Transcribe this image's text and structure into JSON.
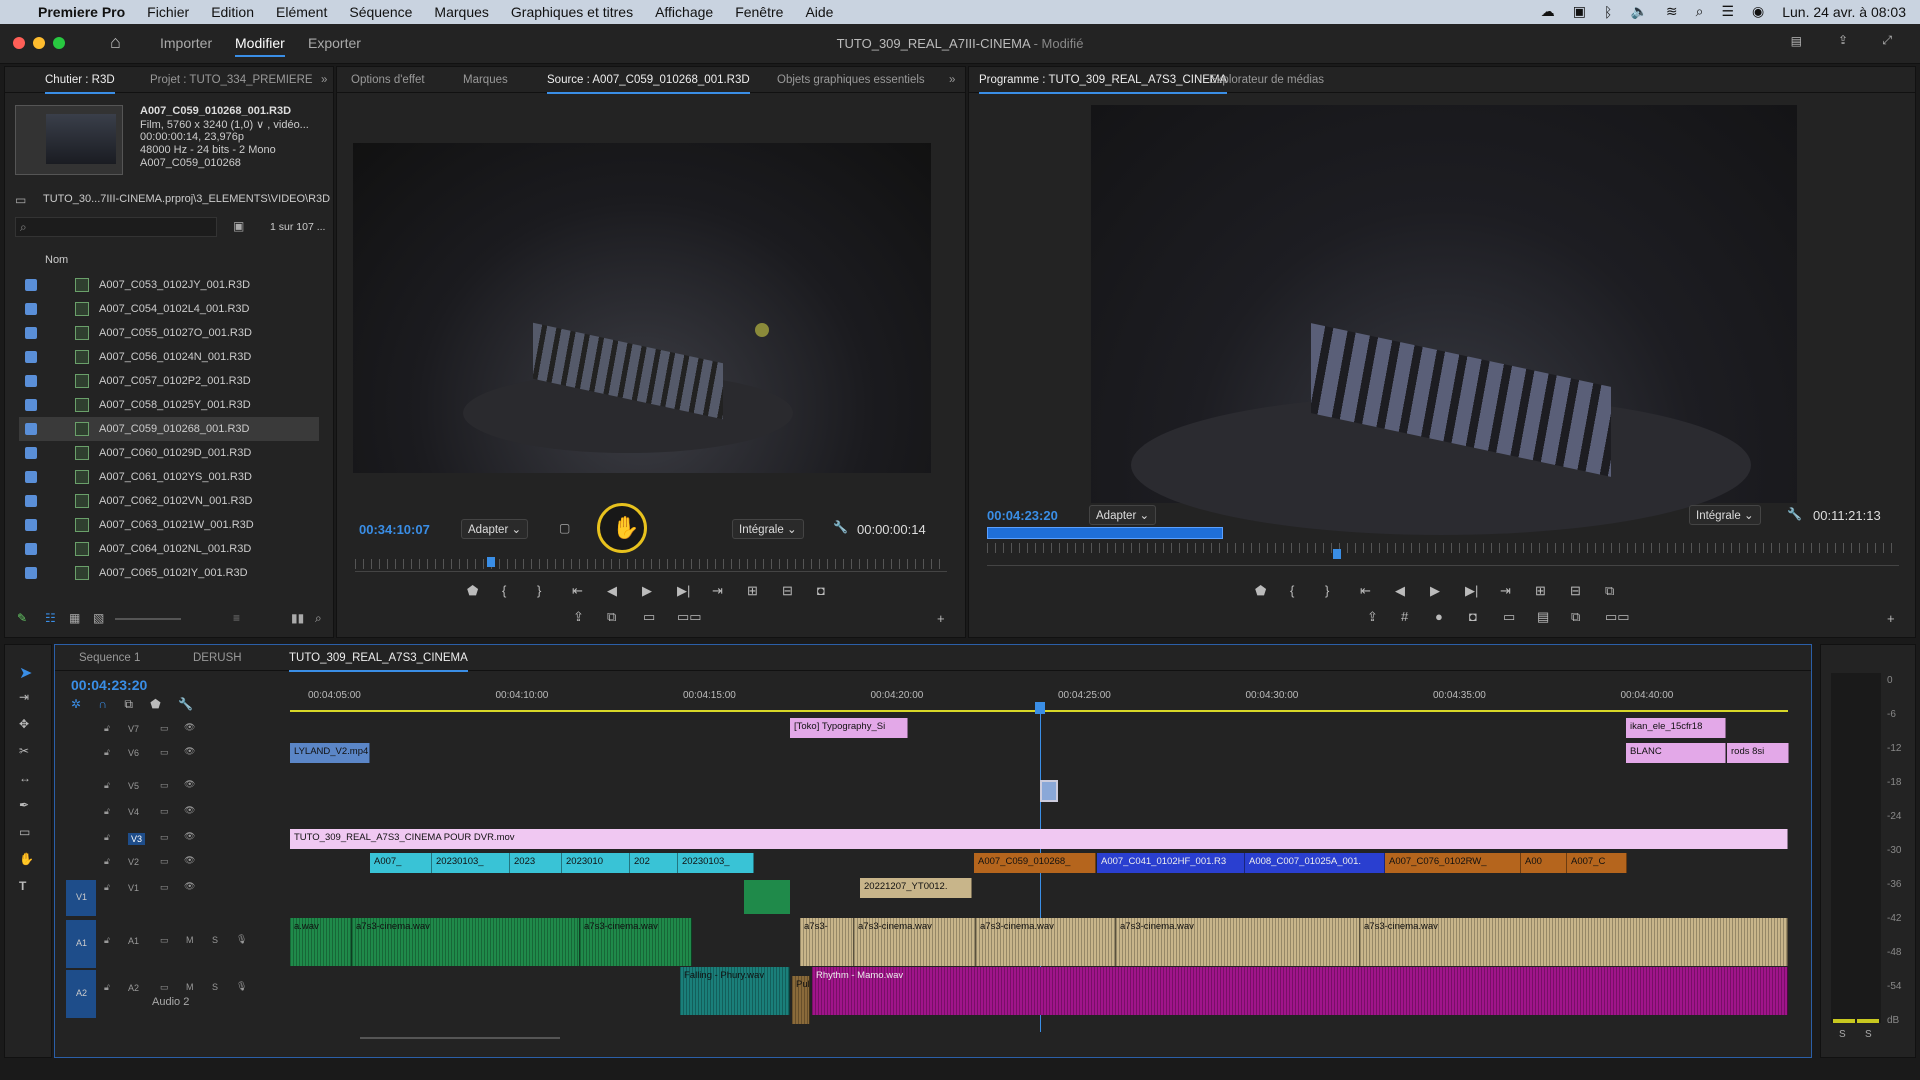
{
  "menubar": {
    "app": "Premiere Pro",
    "items": [
      "Fichier",
      "Edition",
      "Elément",
      "Séquence",
      "Marques",
      "Graphiques et titres",
      "Affichage",
      "Fenêtre",
      "Aide"
    ],
    "datetime": "Lun. 24 avr. à 08:03"
  },
  "titlebar": {
    "tabs": [
      "Importer",
      "Modifier",
      "Exporter"
    ],
    "active_tab": "Modifier",
    "title": "TUTO_309_REAL_A7III-CINEMA",
    "modified": " - Modifié"
  },
  "project": {
    "tabs": [
      "Chutier : R3D",
      "Projet : TUTO_334_PREMIERE"
    ],
    "clip_name": "A007_C059_010268_001.R3D",
    "info": [
      "Film, 5760 x 3240 (1,0) ∨ , vidéo...",
      "00:00:00:14, 23,976p",
      "48000 Hz - 24 bits - 2 Mono",
      "A007_C059_010268"
    ],
    "path": "TUTO_30...7III-CINEMA.prproj\\3_ELEMENTS\\VIDEO\\R3D",
    "count": "1 sur 107 ...",
    "column": "Nom",
    "files": [
      "A007_C053_0102JY_001.R3D",
      "A007_C054_0102L4_001.R3D",
      "A007_C055_01027O_001.R3D",
      "A007_C056_01024N_001.R3D",
      "A007_C057_0102P2_001.R3D",
      "A007_C058_01025Y_001.R3D",
      "A007_C059_010268_001.R3D",
      "A007_C060_01029D_001.R3D",
      "A007_C061_0102YS_001.R3D",
      "A007_C062_0102VN_001.R3D",
      "A007_C063_01021W_001.R3D",
      "A007_C064_0102NL_001.R3D",
      "A007_C065_0102IY_001.R3D"
    ],
    "selected_index": 6
  },
  "source": {
    "tabs": [
      "Options d'effet",
      "Marques",
      "Source : A007_C059_010268_001.R3D",
      "Objets graphiques essentiels"
    ],
    "timecode": "00:34:10:07",
    "fit": "Adapter",
    "quality": "Intégrale",
    "duration": "00:00:00:14"
  },
  "program": {
    "tabs": [
      "Programme : TUTO_309_REAL_A7S3_CINEMA",
      "Explorateur de médias"
    ],
    "timecode": "00:04:23:20",
    "fit": "Adapter",
    "quality": "Intégrale",
    "duration": "00:11:21:13"
  },
  "timeline": {
    "tabs": [
      "Sequence 1",
      "DERUSH",
      "TUTO_309_REAL_A7S3_CINEMA"
    ],
    "timecode": "00:04:23:20",
    "ruler": [
      "00:04:05:00",
      "00:04:10:00",
      "00:04:15:00",
      "00:04:20:00",
      "00:04:25:00",
      "00:04:30:00",
      "00:04:35:00",
      "00:04:40:00"
    ],
    "tracks": [
      "V7",
      "V6",
      "V5",
      "V4",
      "V3",
      "V2",
      "V1",
      "A1",
      "A2"
    ],
    "audio2_label": "Audio 2",
    "clips": {
      "typo": "[Toko] Typography_Si",
      "ikan": "ikan_ele_15cfr18",
      "blanc": "BLANC",
      "rods": "rods 8si",
      "skyland": "LYLAND_V2.mp4",
      "dvr": "TUTO_309_REAL_A7S3_CINEMA POUR DVR.mov",
      "v2a": "A007_",
      "v2b": "20230103_",
      "v2c": "2023",
      "v2d": "2023010",
      "v2e": "202",
      "v2f": "20230103_",
      "v2g": "A007_C059_010268_",
      "v2h": "A007_C041_0102HF_001.R3",
      "v2i": "A008_C007_01025A_001.",
      "v2j": "A007_C076_0102RW_",
      "v2k": "A00",
      "v2l": "A007_C",
      "v1a": "20221207_YT0012.",
      "a1a": "a.wav",
      "a1b": "a7s3-cinema.wav",
      "a1c": "a7s3-cinema.wav",
      "a1d": "a7s3-",
      "a1e": "a7s3-cinema.wav",
      "a1f": "a7s3-cinema.wav",
      "a1g": "a7s3-cinema.wav",
      "a1h": "a7s3-cinema.wav",
      "a2a": "Falling - Phury.wav",
      "a2b": "Pul",
      "a2c": "Rhythm - Mamo.wav"
    }
  },
  "meter": [
    "0",
    "-6",
    "-12",
    "-18",
    "-24",
    "-30",
    "-36",
    "-42",
    "-48",
    "-54",
    "dB"
  ],
  "colors": {
    "accent": "#3a8ee6",
    "pink": "#e3a8e8",
    "cyan": "#39c3d6",
    "orange": "#b5651d",
    "tan": "#c8b58a",
    "green": "#1f8a4a",
    "teal": "#1a7f7a",
    "magenta": "#a0148a"
  }
}
